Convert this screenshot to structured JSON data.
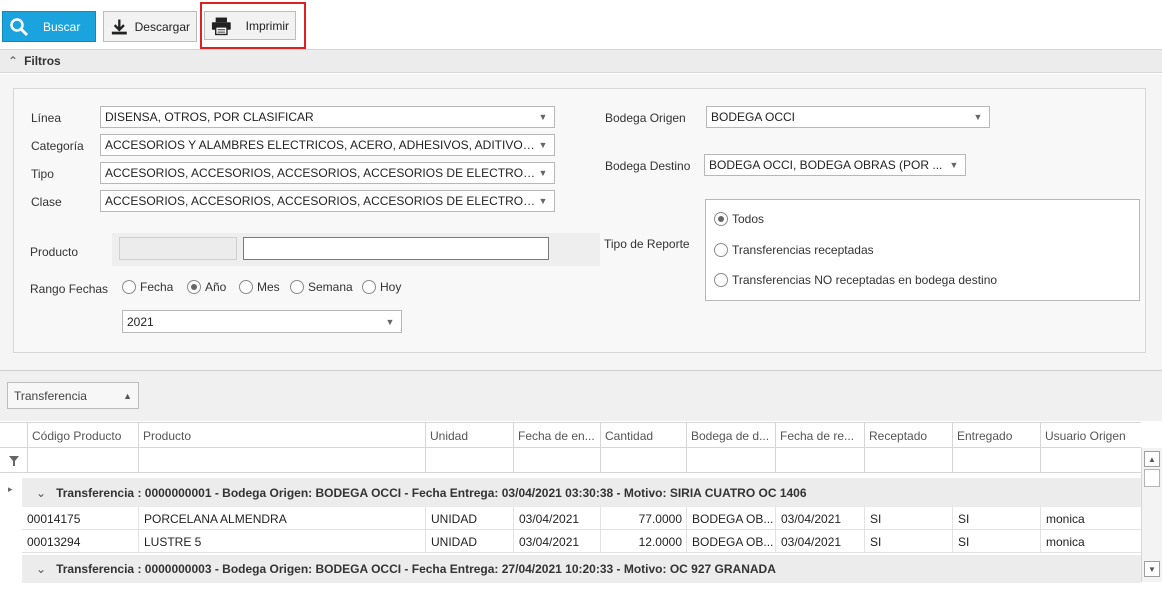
{
  "toolbar": {
    "buscar_label": "Buscar",
    "descargar_label": "Descargar",
    "imprimir_label": "Imprimir"
  },
  "filtros": {
    "title": "Filtros",
    "linea_label": "Línea",
    "linea_value": "DISENSA, OTROS, POR CLASIFICAR",
    "categoria_label": "Categoría",
    "categoria_value": "ACCESORIOS Y ALAMBRES ELECTRICOS, ACERO, ADHESIVOS, ADITIVOS...",
    "tipo_label": "Tipo",
    "tipo_value": "ACCESORIOS, ACCESORIOS, ACCESORIOS, ACCESORIOS DE ELECTROB...",
    "clase_label": "Clase",
    "clase_value": "ACCESORIOS, ACCESORIOS, ACCESORIOS, ACCESORIOS DE ELECTROB...",
    "producto_label": "Producto",
    "producto_code": "",
    "producto_value": "",
    "rango_label": "Rango Fechas",
    "rango_options": [
      "Fecha",
      "Año",
      "Mes",
      "Semana",
      "Hoy"
    ],
    "rango_selected": "Año",
    "year_value": "2021",
    "bodega_origen_label": "Bodega Origen",
    "bodega_origen_value": "BODEGA OCCI",
    "bodega_destino_label": "Bodega Destino",
    "bodega_destino_value": "BODEGA OCCI, BODEGA OBRAS (POR ...",
    "tipo_reporte_label": "Tipo de Reporte",
    "tipo_reporte_options": [
      "Todos",
      "Transferencias receptadas",
      "Transferencias NO receptadas en bodega destino"
    ],
    "tipo_reporte_selected": "Todos"
  },
  "grid": {
    "group_by_label": "Transferencia",
    "columns": [
      "Código Producto",
      "Producto",
      "Unidad",
      "Fecha de en...",
      "Cantidad",
      "Bodega de d...",
      "Fecha de re...",
      "Receptado",
      "Entregado",
      "Usuario Origen"
    ],
    "groups": [
      {
        "header": "Transferencia : 0000000001  -  Bodega Origen: BODEGA OCCI  -  Fecha Entrega: 03/04/2021 03:30:38  -  Motivo: SIRIA CUATRO OC 1406",
        "rows": [
          [
            "00014175",
            "PORCELANA ALMENDRA",
            "UNIDAD",
            "03/04/2021",
            "77.0000",
            "BODEGA OB...",
            "03/04/2021",
            "SI",
            "SI",
            "monica"
          ],
          [
            "00013294",
            "LUSTRE 5",
            "UNIDAD",
            "03/04/2021",
            "12.0000",
            "BODEGA OB...",
            "03/04/2021",
            "SI",
            "SI",
            "monica"
          ]
        ]
      },
      {
        "header": "Transferencia : 0000000003  -  Bodega Origen: BODEGA OCCI  -  Fecha Entrega: 27/04/2021 10:20:33  -  Motivo: OC 927 GRANADA",
        "rows": []
      }
    ]
  },
  "colors": {
    "accent": "#1aa3dc",
    "highlight": "#e02020"
  }
}
